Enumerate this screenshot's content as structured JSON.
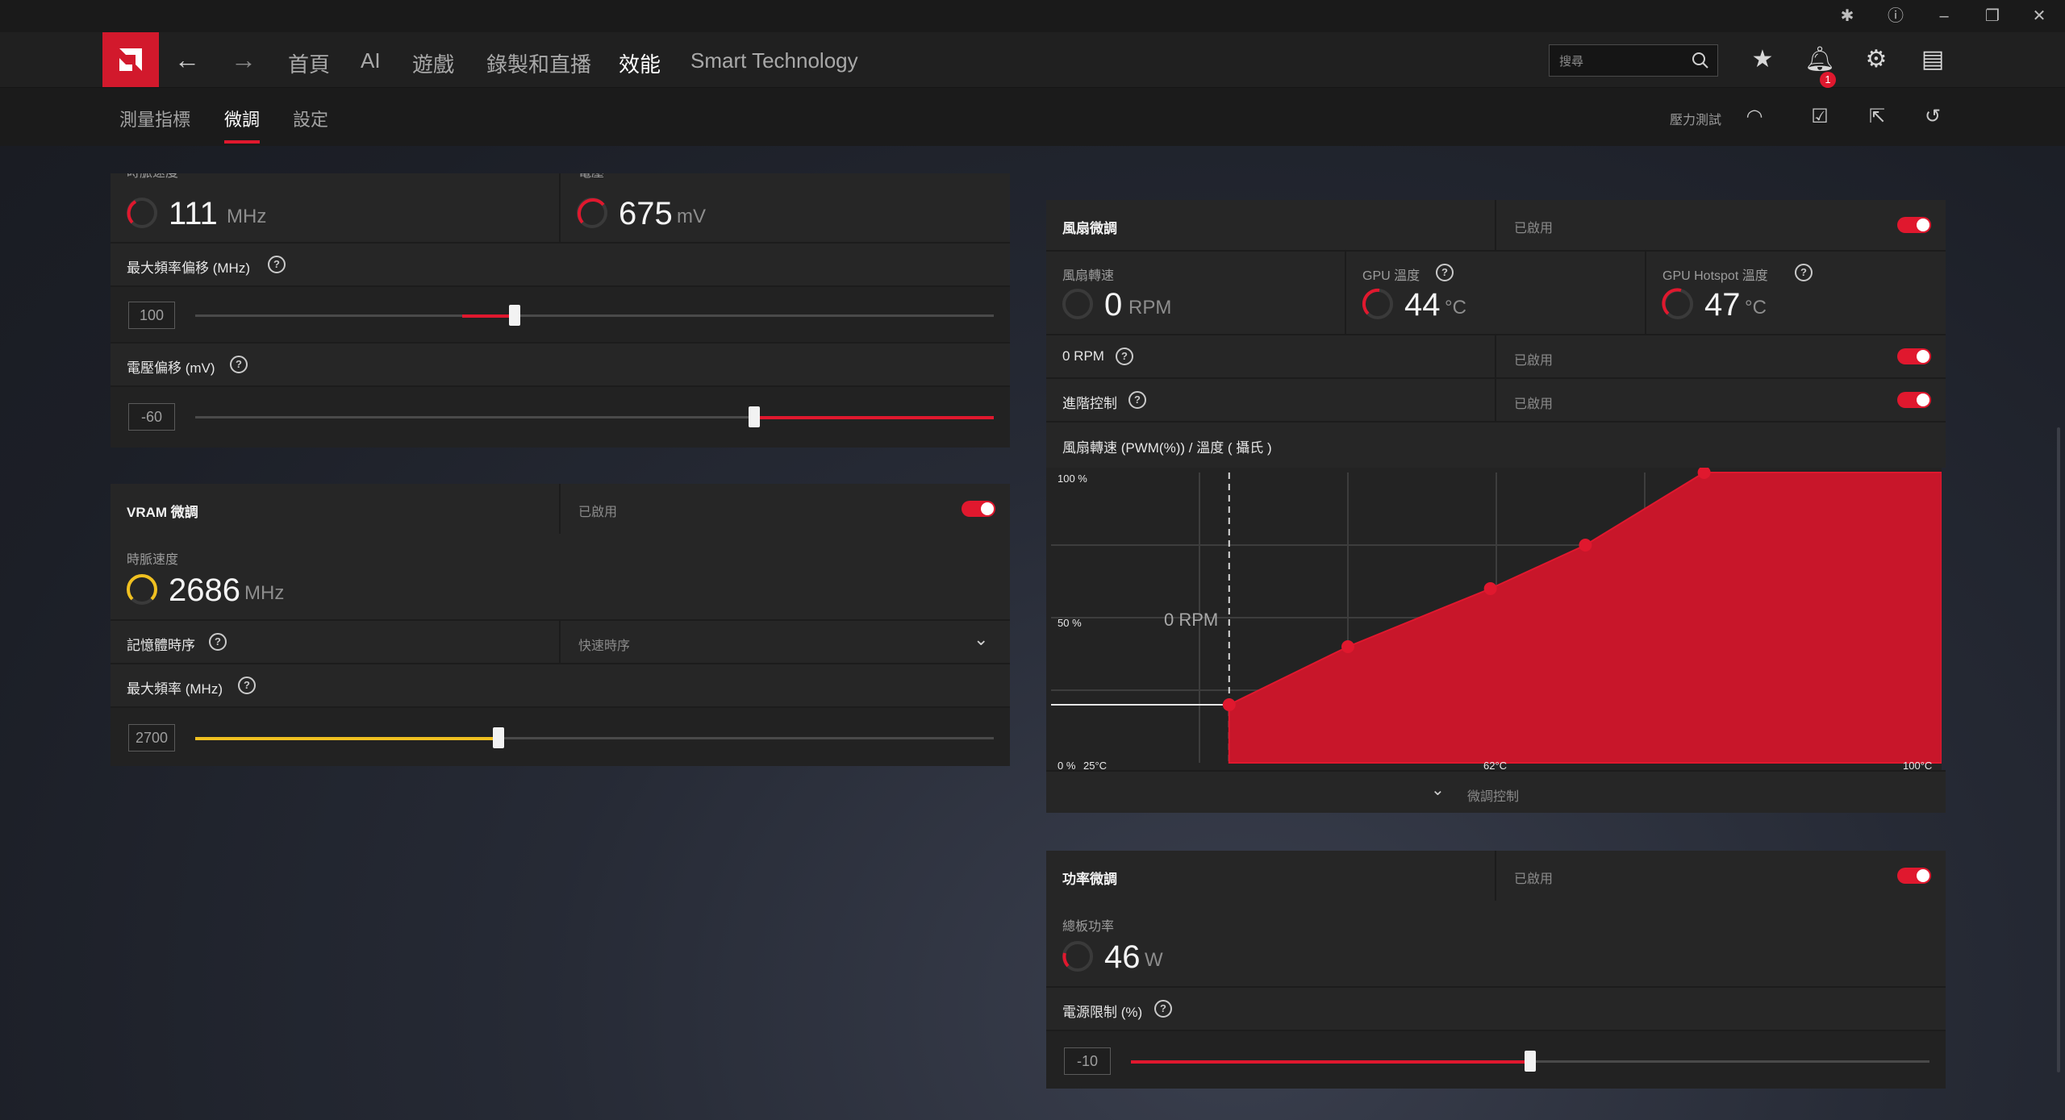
{
  "window_controls": [
    "bug-icon",
    "help-icon",
    "minimize-icon",
    "restore-icon",
    "close-icon"
  ],
  "nav": {
    "tabs": [
      {
        "label": "首頁"
      },
      {
        "label": "AI"
      },
      {
        "label": "遊戲"
      },
      {
        "label": "錄製和直播"
      },
      {
        "label": "效能"
      },
      {
        "label": "Smart Technology"
      }
    ],
    "active_tab": "效能",
    "search_placeholder": "搜尋",
    "notification_count": "1"
  },
  "subnav": {
    "tabs": [
      {
        "label": "測量指標"
      },
      {
        "label": "微調"
      },
      {
        "label": "設定"
      }
    ],
    "active_tab": "微調",
    "stress_test": "壓力測試"
  },
  "gpu_tuning": {
    "clock_label": "時脈速度",
    "clock_value": "111",
    "clock_unit": "MHz",
    "voltage_label": "電壓",
    "voltage_value": "675",
    "voltage_unit": "mV",
    "max_freq_offset_label": "最大頻率偏移 (MHz)",
    "max_freq_offset_value": "100",
    "max_freq_offset_fraction": 0.4,
    "voltage_offset_label": "電壓偏移 (mV)",
    "voltage_offset_value": "-60",
    "voltage_offset_fraction": 0.7
  },
  "vram": {
    "title": "VRAM 微調",
    "status": "已啟用",
    "clock_label": "時脈速度",
    "clock_value": "2686",
    "clock_unit": "MHz",
    "memory_timing_label": "記憶體時序",
    "memory_timing_value": "快速時序",
    "max_freq_label": "最大頻率 (MHz)",
    "max_freq_value": "2700",
    "max_freq_fraction": 0.38
  },
  "fan": {
    "title": "風扇微調",
    "status": "已啟用",
    "speed_label": "風扇轉速",
    "speed_value": "0",
    "speed_unit": "RPM",
    "gpu_temp_label": "GPU 溫度",
    "gpu_temp_value": "44",
    "gpu_temp_unit": "°C",
    "hotspot_label": "GPU Hotspot 溫度",
    "hotspot_value": "47",
    "hotspot_unit": "°C",
    "zero_rpm_label": "0 RPM",
    "zero_rpm_status": "已啟用",
    "advanced_label": "進階控制",
    "advanced_status": "已啟用",
    "curve_title": "風扇轉速 (PWM(%)) / 溫度 ( 攝氏 )",
    "tuning_control_label": "微調控制"
  },
  "chart_data": {
    "type": "area",
    "title": "風扇轉速 (PWM(%)) / 溫度 ( 攝氏 )",
    "xlabel": "",
    "ylabel": "",
    "x_ticks": [
      "25°C",
      "62°C",
      "100°C"
    ],
    "y_ticks": [
      "0 %",
      "50 %",
      "100 %"
    ],
    "xlim": [
      25,
      100
    ],
    "ylim": [
      0,
      100
    ],
    "annotation": "0 RPM",
    "zero_rpm_until": 40,
    "series": [
      {
        "x": [
          40,
          50,
          62,
          70,
          80,
          100
        ],
        "y": [
          20,
          40,
          60,
          75,
          100,
          100
        ]
      }
    ],
    "grid": true
  },
  "power": {
    "title": "功率微調",
    "status": "已啟用",
    "board_power_label": "總板功率",
    "board_power_value": "46",
    "board_power_unit": "W",
    "power_limit_label": "電源限制 (%)",
    "power_limit_value": "-10",
    "power_limit_fraction": 0.5
  },
  "colors": {
    "accent": "#e0182e",
    "vram_accent": "#f0c020",
    "panel": "#262626"
  }
}
